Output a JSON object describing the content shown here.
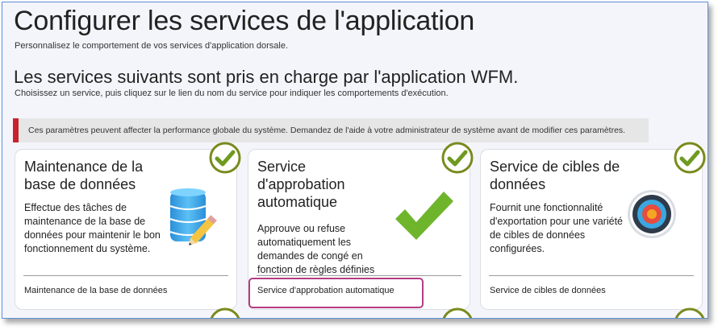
{
  "page": {
    "title": "Configurer les services de l'application",
    "subtitle": "Personnalisez le comportement de vos services d'application dorsale.",
    "section_title": "Les services suivants sont pris en charge par l'application WFM.",
    "section_subtitle": "Choisissez un service, puis cliquez sur le lien du nom du service pour indiquer les comportements d'exécution."
  },
  "warning": {
    "text": "Ces paramètres peuvent affecter la performance globale du système. Demandez de l'aide à votre administrateur de système avant de modifier ces paramètres.",
    "color": "#c8232c"
  },
  "cards": [
    {
      "title": "Maintenance de la base de données",
      "description": "Effectue des tâches de maintenance de la base de données pour maintenir le bon fonctionnement du système.",
      "link": "Maintenance de la base de données",
      "icon": "database-pencil-icon"
    },
    {
      "title": "Service d'approbation automatique",
      "description": "Approuve ou refuse automatiquement les demandes de congé en fonction de règles définies",
      "link": "Service d'approbation automatique",
      "icon": "large-checkmark-icon"
    },
    {
      "title": "Service de cibles de données",
      "description": "Fournit une fonctionnalité d'exportation pour une variété de cibles de données configurées.",
      "link": "Service de cibles de données",
      "icon": "target-icon"
    }
  ],
  "colors": {
    "check_green": "#6f9a1f",
    "check_border": "#7a8a1c",
    "highlight": "#b43c83"
  }
}
